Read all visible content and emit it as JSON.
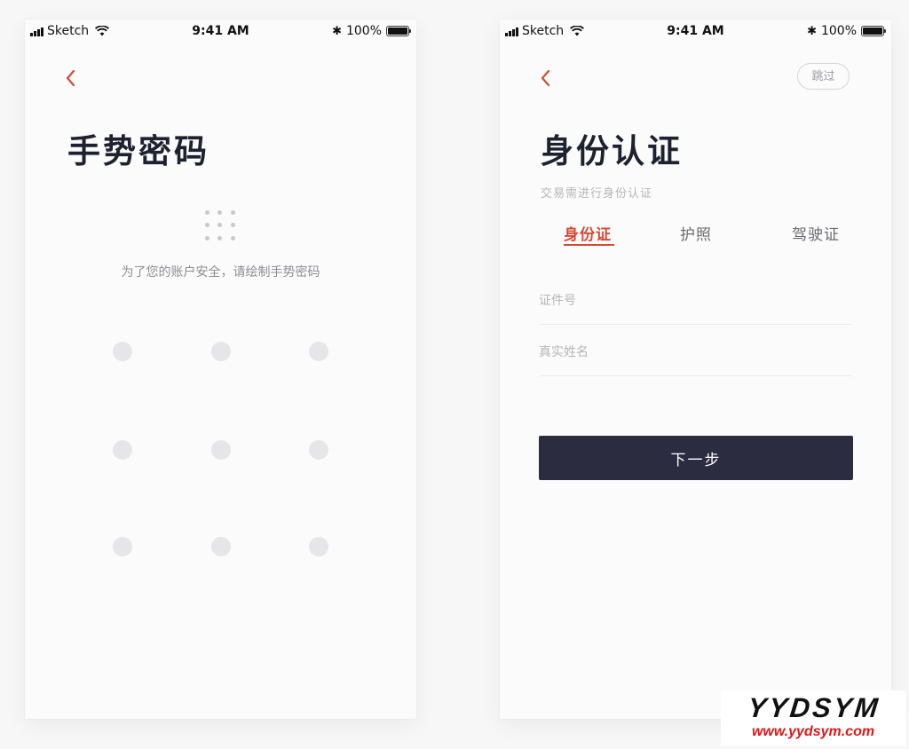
{
  "status_bar": {
    "carrier": "Sketch",
    "time": "9:41 AM",
    "battery": "100%",
    "battery_level": 1.0,
    "bluetooth_icon": "bluetooth-icon",
    "wifi_icon": "wifi-icon",
    "signal_icon": "signal-icon"
  },
  "gesture_screen": {
    "title": "手势密码",
    "hint": "为了您的账户安全，请绘制手势密码",
    "pattern_points": 9
  },
  "verify_screen": {
    "skip_label": "跳过",
    "title": "身份认证",
    "subtitle": "交易需进行身份认证",
    "tabs": [
      {
        "label": "身份证",
        "active": true
      },
      {
        "label": "护照",
        "active": false
      },
      {
        "label": "驾驶证",
        "active": false
      }
    ],
    "fields": {
      "id_number": {
        "placeholder": "证件号",
        "value": ""
      },
      "real_name": {
        "placeholder": "真实姓名",
        "value": ""
      }
    },
    "next_label": "下一步"
  },
  "colors": {
    "accent": "#d34a35",
    "primary_button": "#2c2c40",
    "title_text": "#1e2230",
    "muted_text": "#b6b6ba",
    "pattern_dot": "#e6e6e8"
  },
  "watermark": {
    "logo": "YYDSYM",
    "url": "www.yydsym.com"
  }
}
